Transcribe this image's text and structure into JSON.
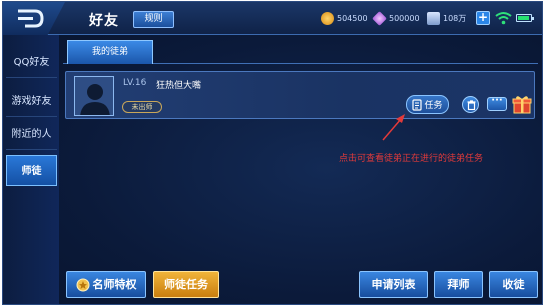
{
  "topbar": {
    "title": "好友",
    "rules_label": "规则",
    "gold": "504500",
    "diamond": "500000",
    "voucher": "108万"
  },
  "sidebar": {
    "items": [
      {
        "label": "QQ好友",
        "active": false
      },
      {
        "label": "游戏好友",
        "active": false
      },
      {
        "label": "附近的人",
        "active": false
      },
      {
        "label": "师徒",
        "active": true
      }
    ]
  },
  "tabs": [
    {
      "label": "我的徒弟",
      "active": true
    }
  ],
  "apprentice": {
    "level": "LV.16",
    "name": "狂热但大嘴",
    "status": "未出师",
    "task_label": "任务"
  },
  "annotation": {
    "text": "点击可查看徒弟正在进行的徒弟任务",
    "color": "#e23a3a"
  },
  "bottom": {
    "mentor_privilege": "名师特权",
    "mentor_task": "师徒任务",
    "apply_list": "申请列表",
    "bow_master": "拜师",
    "take_apprentice": "收徒"
  }
}
